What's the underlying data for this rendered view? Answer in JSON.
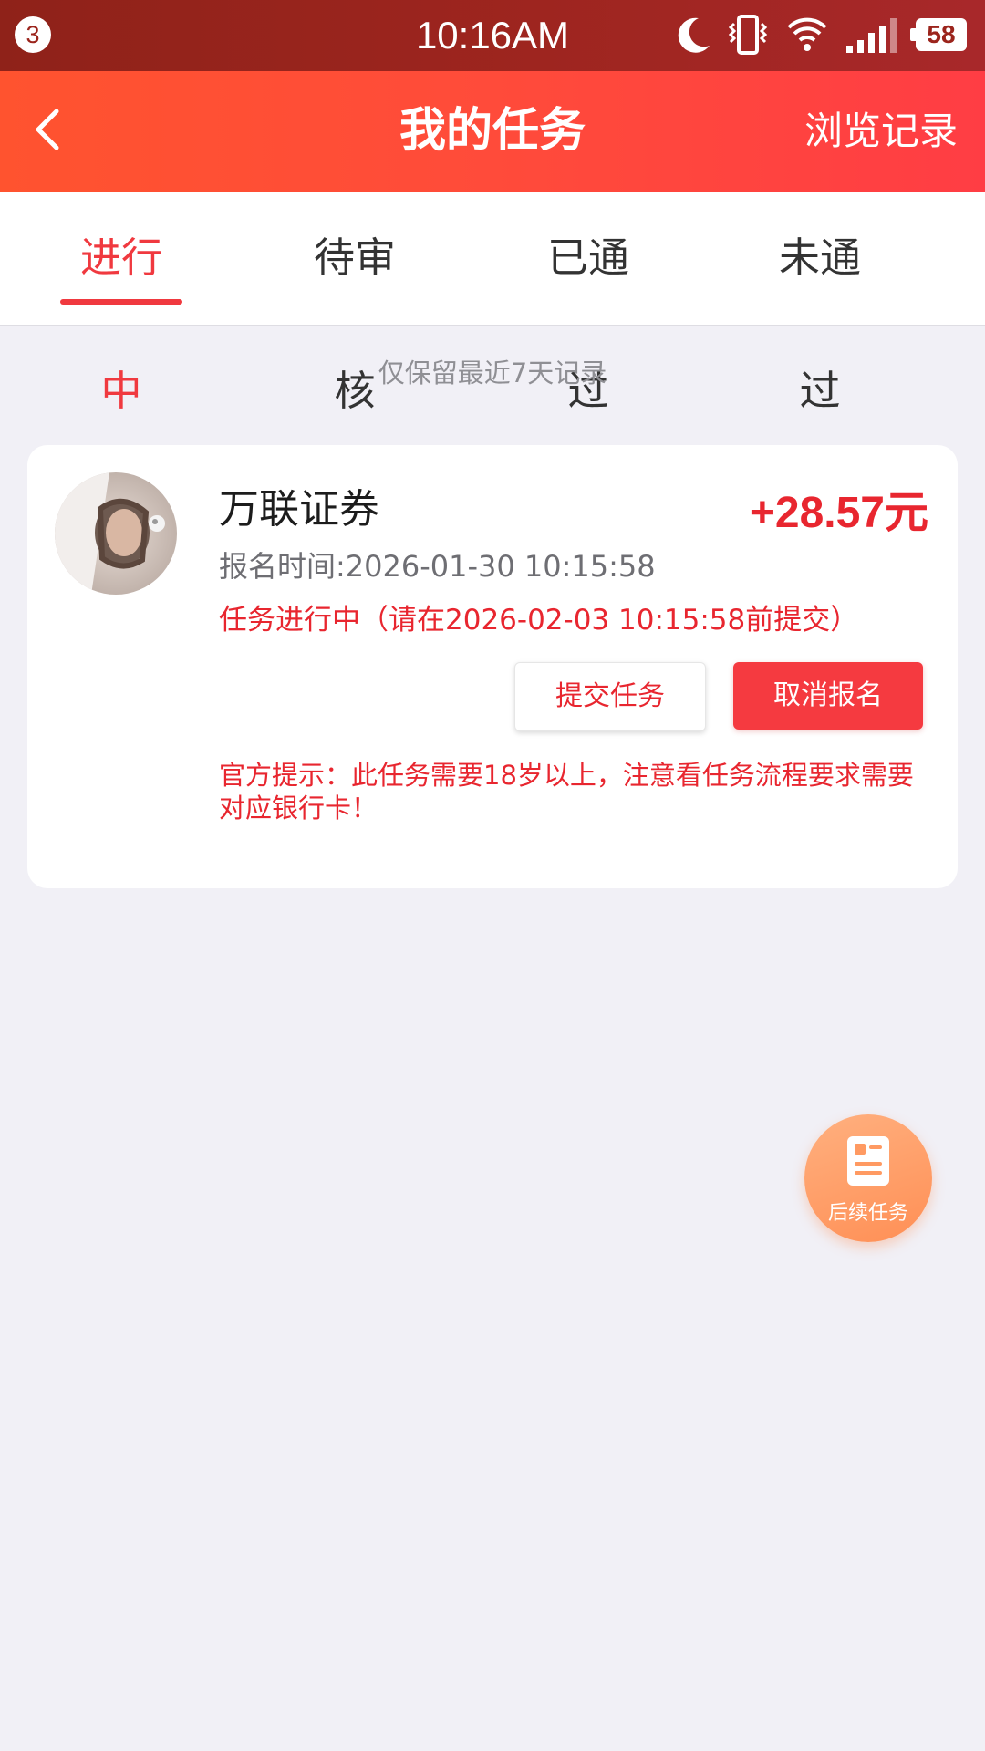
{
  "status_bar": {
    "notification_count": "3",
    "time": "10:16AM",
    "battery": "58",
    "icons": [
      "moon-icon",
      "vibrate-icon",
      "wifi-icon",
      "signal-icon",
      "battery-icon"
    ]
  },
  "header": {
    "title": "我的任务",
    "right_link": "浏览记录",
    "back_icon": "chevron-left-icon"
  },
  "tabs": [
    {
      "label": "进行中",
      "active": true
    },
    {
      "label": "待审核",
      "active": false
    },
    {
      "label": "已通过",
      "active": false
    },
    {
      "label": "未通过",
      "active": false
    }
  ],
  "notice": "仅保留最近7天记录",
  "task": {
    "name": "万联证券",
    "reward": "+28.57元",
    "signup_time": "报名时间:2026-01-30 10:15:58",
    "status": "任务进行中（请在2026-02-03 10:15:58前提交）",
    "submit_label": "提交任务",
    "cancel_label": "取消报名",
    "official_tip": "官方提示：此任务需要18岁以上，注意看任务流程要求需要对应银行卡！"
  },
  "fab": {
    "label": "后续任务",
    "icon": "document-icon"
  },
  "colors": {
    "accent": "#f0393f",
    "status_bar": "#9b241c",
    "header": "#ff4b3a",
    "background": "#f1f0f6",
    "fab": "#ff9a62"
  }
}
